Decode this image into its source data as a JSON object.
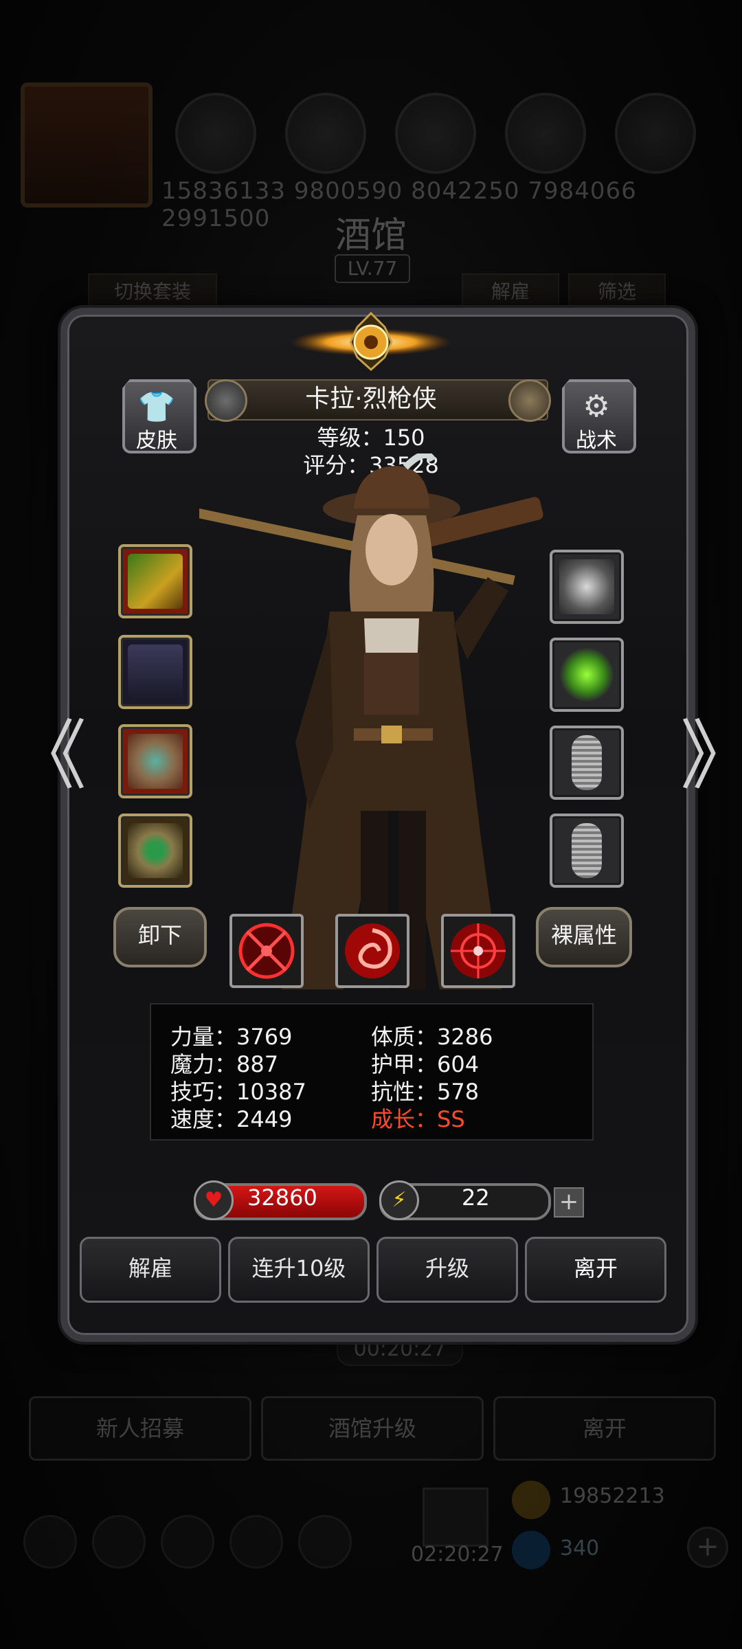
{
  "background": {
    "header_numbers": "15836133 9800590 8042250 7984066 2991500",
    "tavern_title": "酒馆",
    "tavern_level": "LV.77",
    "tab_switch_outfit": "切换套装",
    "tab_dismiss": "解雇",
    "tab_filter": "筛选",
    "timer": "00:20:27",
    "buttons": [
      "新人招募",
      "酒馆升级",
      "离开"
    ],
    "bottom_timer": "02:20:27",
    "coins": "19852213",
    "gems": "340"
  },
  "hero": {
    "name": "卡拉·烈枪侠",
    "level_text": "等级：150",
    "score_text": "评分：33528"
  },
  "side_buttons": {
    "skin": "皮肤",
    "tactics": "战术"
  },
  "equipment": {
    "left": [
      "golden-rifle",
      "dark-coat-armor",
      "jeweled-amulet",
      "emerald-ring"
    ],
    "right": [
      "cloud-ornament",
      "green-crystal",
      "empty-slot",
      "empty-slot"
    ]
  },
  "actions_row": {
    "unequip": "卸下",
    "base_attributes": "裸属性",
    "skills": [
      "crosshair-skill",
      "vortex-skill",
      "target-skill"
    ]
  },
  "stats": {
    "strength": "力量：3769",
    "magic": "魔力：887",
    "skill": "技巧：10387",
    "speed": "速度：2449",
    "constitution": "体质：3286",
    "armor": "护甲：604",
    "resistance": "抗性：578",
    "growth": "成长：SS"
  },
  "bars": {
    "hp": "32860",
    "energy": "22",
    "energy_fill": 0.16,
    "plus": "+"
  },
  "buttons": {
    "dismiss": "解雇",
    "level_up_10": "连升10级",
    "level_up": "升级",
    "leave": "离开"
  },
  "nav": {
    "prev": "《",
    "next": "》"
  },
  "colors": {
    "accent_gold": "#b7a067",
    "hp_red": "#d51515",
    "energy_yellow": "#d9c20e",
    "growth_red": "#ff4a2a"
  }
}
